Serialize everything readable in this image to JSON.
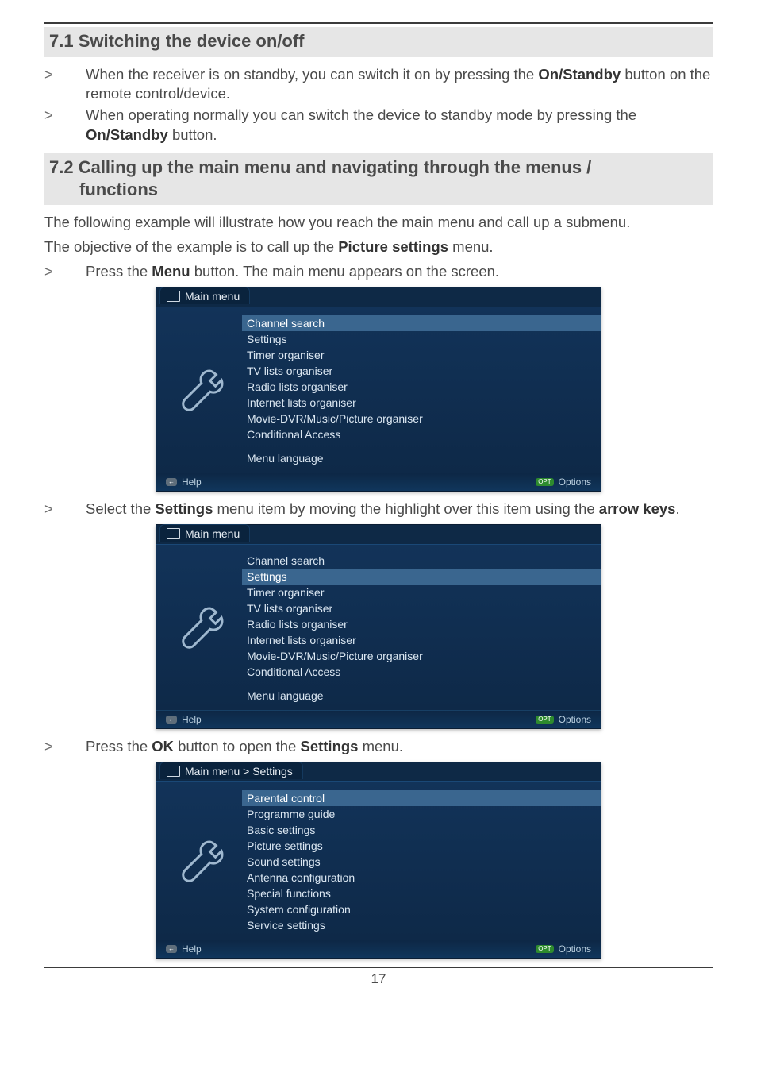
{
  "sections": {
    "s71": {
      "title": "7.1 Switching the device on/off",
      "b1_pre": "When the receiver is on standby, you can switch it on by pressing the ",
      "b1_bold": "On/Standby",
      "b1_post": " button on the remote control/device.",
      "b2_pre": "When operating normally you can switch the device to standby mode by pressing the ",
      "b2_bold": "On/Standby",
      "b2_post": " button."
    },
    "s72": {
      "title_line1": "7.2 Calling up the main menu and navigating through the menus /",
      "title_line2": "functions",
      "intro_line1": "The following example will illustrate how you reach the main menu and call up a submenu.",
      "intro2_pre": "The objective of the example is to call up the ",
      "intro2_bold": "Picture settings",
      "intro2_post": " menu.",
      "step1_pre": "Press the ",
      "step1_bold": "Menu",
      "step1_post": " button. The main menu appears on the screen.",
      "step2_pre": "Select the ",
      "step2_b1": "Settings",
      "step2_mid": " menu item by moving the highlight over this item using the ",
      "step2_b2": "arrow keys",
      "step2_post": ".",
      "step3_pre": "Press the ",
      "step3_b1": "OK",
      "step3_mid": " button to open the ",
      "step3_b2": "Settings",
      "step3_post": " menu."
    }
  },
  "marker": ">",
  "osd": {
    "main_title": "Main menu",
    "settings_title": "Main menu > Settings",
    "help": "Help",
    "options": "Options",
    "pill_back": "←",
    "pill_opt": "OPT",
    "items": {
      "channel_search": "Channel search",
      "settings": "Settings",
      "timer": "Timer organiser",
      "tvlists": "TV lists organiser",
      "radio": "Radio lists organiser",
      "internet": "Internet lists organiser",
      "movie": "Movie-DVR/Music/Picture organiser",
      "cond": "Conditional Access",
      "lang": "Menu language"
    },
    "settings_items": {
      "parental": "Parental control",
      "pg": "Programme guide",
      "basic": "Basic settings",
      "picture": "Picture settings",
      "sound": "Sound settings",
      "antenna": "Antenna configuration",
      "special": "Special functions",
      "sysconf": "System configuration",
      "service": "Service settings"
    }
  },
  "page_number": "17"
}
